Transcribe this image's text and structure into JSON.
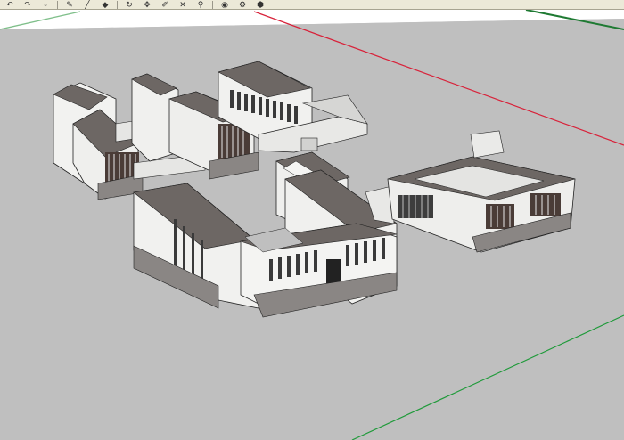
{
  "toolbar": {
    "groups": [
      [
        {
          "icon": "undo-icon",
          "glyph": "↶"
        },
        {
          "icon": "redo-icon",
          "glyph": "↷"
        },
        {
          "icon": "select-icon",
          "glyph": "▫"
        }
      ],
      [
        {
          "icon": "pencil-icon",
          "glyph": "✎"
        },
        {
          "icon": "line-icon",
          "glyph": "╱"
        },
        {
          "icon": "paint-bucket-icon",
          "glyph": "◆"
        }
      ],
      [
        {
          "icon": "rotate-icon",
          "glyph": "↻"
        },
        {
          "icon": "move-icon",
          "glyph": "✥"
        },
        {
          "icon": "tape-measure-icon",
          "glyph": "✐"
        },
        {
          "icon": "eraser-icon",
          "glyph": "✕"
        },
        {
          "icon": "zoom-icon",
          "glyph": "⚲"
        }
      ],
      [
        {
          "icon": "camera-icon",
          "glyph": "◉"
        },
        {
          "icon": "walk-icon",
          "glyph": "⚙"
        },
        {
          "icon": "component-icon",
          "glyph": "⬢"
        }
      ]
    ]
  },
  "viewport": {
    "sky_color": "#ffffff",
    "ground_color": "#bfbfbf",
    "axis_colors": {
      "red": "#d8223a",
      "green": "#1f9a3a"
    },
    "roof_color": "#6d6764",
    "wall_color": "#f2f2f0",
    "window_color": "#3a3a3a"
  }
}
